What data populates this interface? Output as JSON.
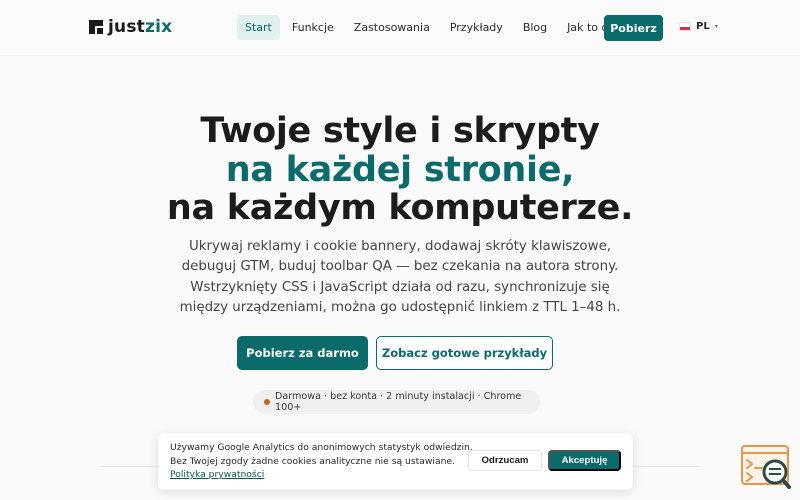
{
  "header": {
    "logo_part1": "just",
    "logo_part2": "zix",
    "nav": [
      {
        "label": "Start"
      },
      {
        "label": "Funkcje"
      },
      {
        "label": "Zastosowania"
      },
      {
        "label": "Przykłady"
      },
      {
        "label": "Blog"
      },
      {
        "label": "Jak to działa"
      }
    ],
    "cta_label": "Pobierz",
    "lang_code": "PL",
    "lang_caret": "▾"
  },
  "hero": {
    "line1": "Twoje style i skrypty",
    "line2": "na każdej stronie,",
    "line3": "na każdym komputerze.",
    "subtitle": "Ukrywaj reklamy i cookie bannery, dodawaj skróty klawiszowe, debuguj GTM, buduj toolbar QA — bez czekania na autora strony. Wstrzyknięty CSS i JavaScript działa od razu, synchronizuje się między urządzeniami, można go udostępnić linkiem z TTL 1–48 h.",
    "primary_label": "Pobierz za darmo",
    "secondary_label": "Zobacz gotowe przykłady",
    "pill_text": "Darmowa · bez konta · 2 minuty instalacji · Chrome 100+"
  },
  "cookie": {
    "line1": "Używamy Google Analytics do anonimowych statystyk odwiedzin.",
    "line2": "Bez Twojej zgody żadne cookies analityczne nie są ustawiane.",
    "link_label": "Polityka prywatności",
    "reject_label": "Odrzucam",
    "accept_label": "Akceptuję"
  },
  "colors": {
    "accent": "#0b6b6b",
    "status_dot": "#c8651b",
    "widget_orange": "#e8964a"
  },
  "icons": {
    "logo": "justzix-logo-icon",
    "flag": "poland-flag-icon",
    "widget": "code-search-icon"
  }
}
